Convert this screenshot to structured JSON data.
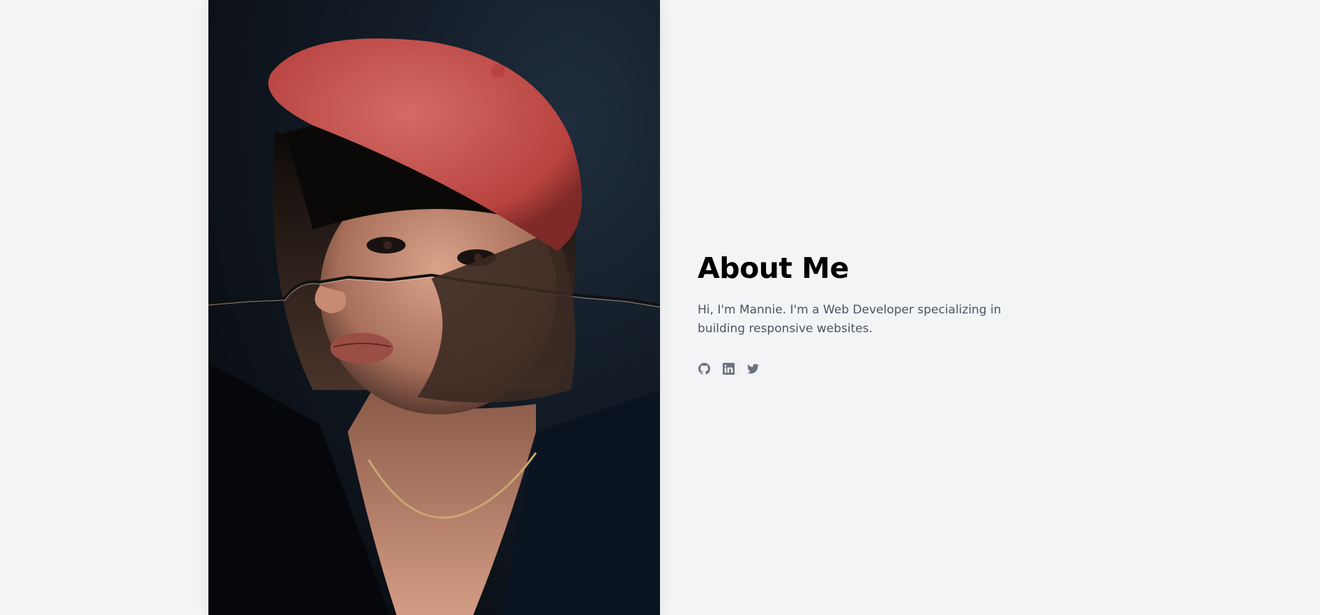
{
  "about": {
    "title": "About Me",
    "bio": "Hi, I'm Mannie. I'm a Web Developer specializing in building responsive websites."
  },
  "socials": [
    {
      "icon": "github-icon"
    },
    {
      "icon": "linkedin-icon"
    },
    {
      "icon": "twitter-icon"
    }
  ],
  "colors": {
    "background": "#f3f4f6",
    "title": "#000000",
    "text": "#4b5563",
    "icon": "#6b7280",
    "beret": "#c8524f"
  }
}
